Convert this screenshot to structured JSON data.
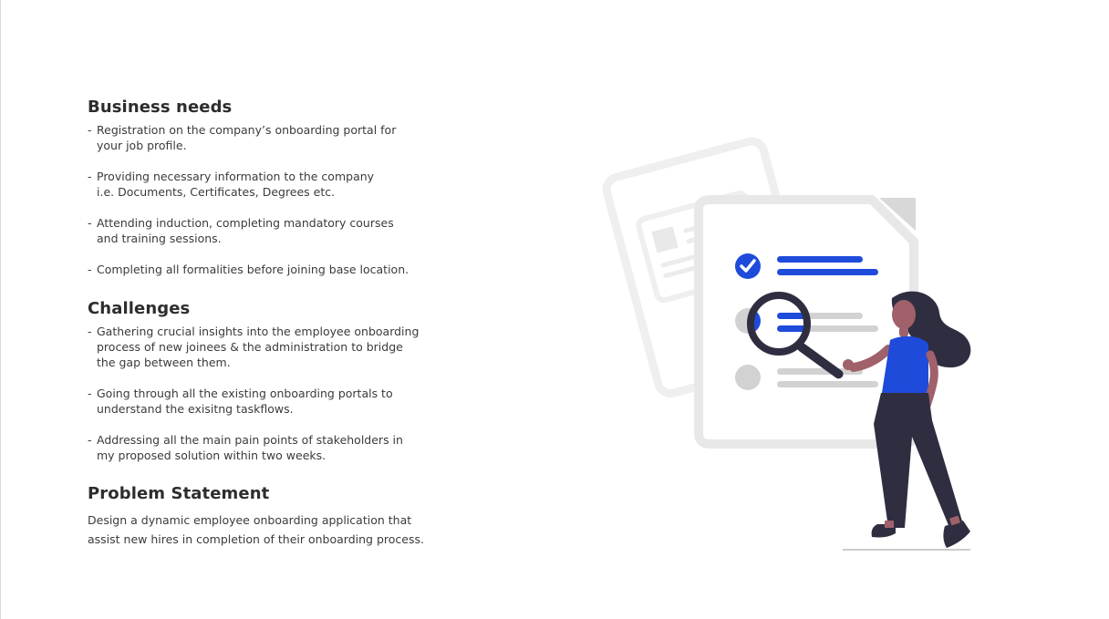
{
  "sections": {
    "business_needs": {
      "title": "Business needs",
      "items": [
        "Registration on the company’s onboarding portal for\nyour job profile.",
        "Providing necessary information to the company\ni.e. Documents, Certificates, Degrees etc.",
        "Attending induction, completing mandatory courses\nand training sessions.",
        "Completing all formalities before joining base location."
      ]
    },
    "challenges": {
      "title": "Challenges",
      "items": [
        "Gathering crucial insights into the employee onboarding\nprocess of new joinees & the administration to bridge\nthe gap between them.",
        "Going through all the existing onboarding portals to\nunderstand the exisitng taskflows.",
        "Addressing all the main pain points of stakeholders in\nmy proposed solution within two weeks."
      ]
    },
    "problem_statement": {
      "title": "Problem Statement",
      "text": "Design a dynamic employee onboarding application that\nassist new hires in completion of their onboarding process."
    }
  },
  "illustration": {
    "icon": "onboarding-document-review-illustration",
    "colors": {
      "accent": "#1F4BDB",
      "paper_border": "#E6E6E6",
      "paper_fill": "#FFFFFF",
      "placeholder_gray": "#D0D0D0",
      "person_dark": "#2F2E41",
      "skin": "#A0616A"
    }
  }
}
